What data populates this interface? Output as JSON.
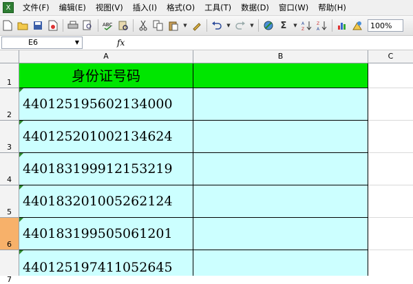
{
  "menu": {
    "items": [
      "文件(F)",
      "编辑(E)",
      "视图(V)",
      "插入(I)",
      "格式(O)",
      "工具(T)",
      "数据(D)",
      "窗口(W)",
      "帮助(H)"
    ]
  },
  "toolbar": {
    "zoom": "100%",
    "sigma": "Σ"
  },
  "formula_bar": {
    "name_box": "E6",
    "fx_label": "fx"
  },
  "columns": [
    "A",
    "B",
    "C"
  ],
  "rows": [
    "1",
    "2",
    "3",
    "4",
    "5",
    "6",
    "7"
  ],
  "sheet": {
    "header": "身份证号码",
    "ids": [
      "440125195602134000",
      "440125201002134624",
      "440183199912153219",
      "440183201005262124",
      "440183199505061201",
      "440125197411052645"
    ]
  },
  "colors": {
    "header_fill": "#00e600",
    "data_fill": "#ccffff",
    "active_row_header": "#f7b16a"
  }
}
